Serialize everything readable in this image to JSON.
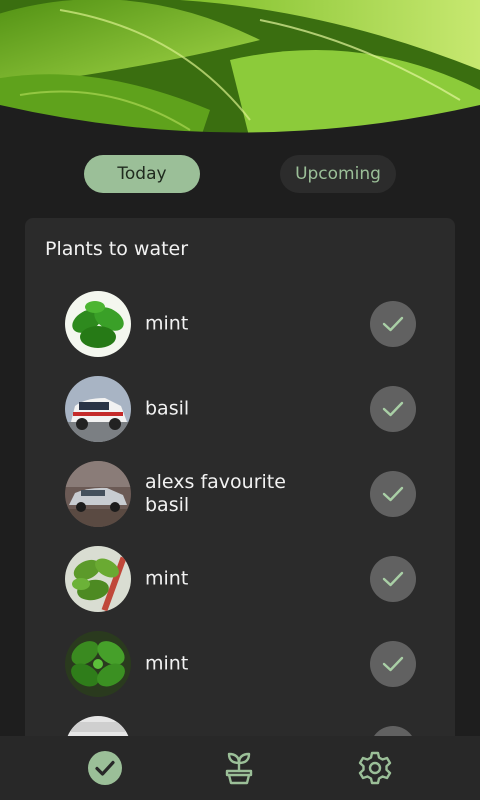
{
  "tabs": [
    {
      "label": "Today",
      "active": true
    },
    {
      "label": "Upcoming",
      "active": false
    }
  ],
  "section": {
    "title": "Plants to water"
  },
  "plants": [
    {
      "name": "mint",
      "photo": "mint-leaves-photo"
    },
    {
      "name": "basil",
      "photo": "rally-car-photo"
    },
    {
      "name": "alexs favourite basil",
      "photo": "silver-car-photo"
    },
    {
      "name": "mint",
      "photo": "potted-plant-photo"
    },
    {
      "name": "mint",
      "photo": "basil-leaves-photo"
    },
    {
      "name": "",
      "photo": "partial-photo"
    }
  ],
  "nav": [
    {
      "id": "tasks",
      "icon": "check-circle-icon",
      "active": true
    },
    {
      "id": "plants",
      "icon": "sprout-pot-icon",
      "active": false
    },
    {
      "id": "settings",
      "icon": "gear-icon",
      "active": false
    }
  ],
  "colors": {
    "background": "#1e1e1e",
    "card": "#2b2b2b",
    "accent": "#9bbf98",
    "nav_bar": "#282828",
    "check_button": "#616161"
  }
}
